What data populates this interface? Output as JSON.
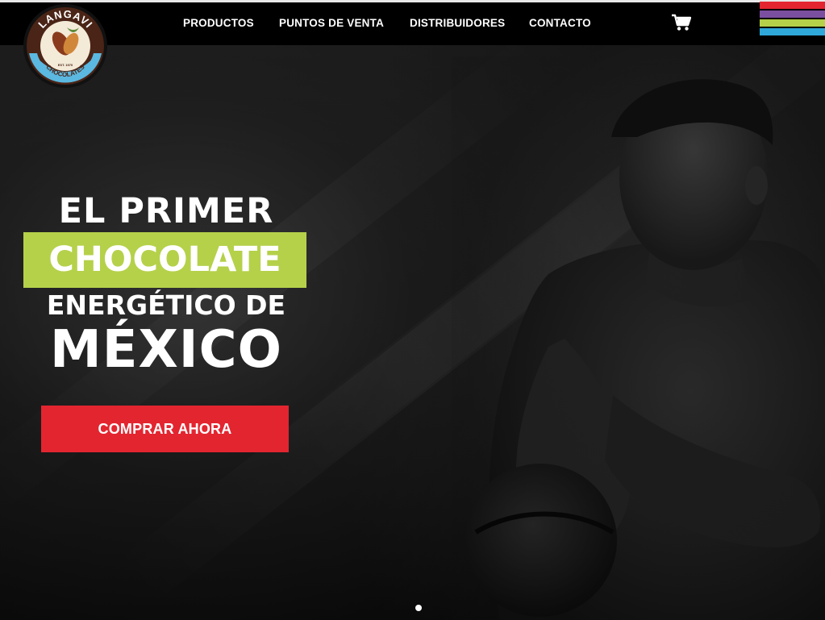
{
  "brand": {
    "logo_text_top": "LANGAVI",
    "logo_text_est": "EST. 1970",
    "logo_text_bottom": "CHOCOLATES"
  },
  "nav": {
    "items": [
      {
        "label": "PRODUCTOS"
      },
      {
        "label": "PUNTOS DE VENTA"
      },
      {
        "label": "DISTRIBUIDORES"
      },
      {
        "label": "CONTACTO"
      }
    ],
    "cart_icon": "shopping-cart-icon"
  },
  "stripes": {
    "colors": [
      "#e32530",
      "#7b4fa0",
      "#b5d14a",
      "#2fa7d9"
    ]
  },
  "hero": {
    "line1": "EL PRIMER",
    "line2": "CHOCOLATE",
    "line3": "ENERGÉTICO DE",
    "line4": "MÉXICO",
    "cta_label": "COMPRAR AHORA"
  },
  "colors": {
    "accent_green": "#b5d14a",
    "cta_red": "#e32530",
    "logo_blue": "#5bb8e0",
    "logo_brown": "#5a2a1a"
  },
  "slider": {
    "active_index": 1,
    "count": 1
  }
}
